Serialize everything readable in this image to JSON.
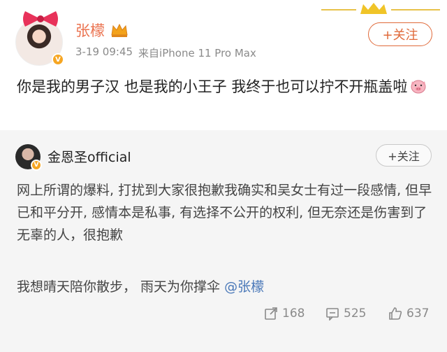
{
  "post": {
    "author": "张檬",
    "time": "3-19 09:45",
    "source": "来自iPhone 11 Pro Max",
    "follow_label": "+关注",
    "text": "你是我的男子汉 也是我的小王子 我终于也可以拧不开瓶盖啦",
    "emoji_icon": "pig-face-icon"
  },
  "repost": {
    "author": "金恩圣official",
    "follow_label": "+关注",
    "paragraph1": "网上所谓的爆料, 打扰到大家很抱歉我确实和吴女士有过一段感情, 但早已和平分开, 感情本是私事, 有选择不公开的权利, 但无奈还是伤害到了无辜的人，很抱歉",
    "paragraph2_prefix": "我想晴天陪你散步，  雨天为你撑伞 ",
    "mention": "@张檬",
    "reposts": "168",
    "comments": "525",
    "likes": "637"
  },
  "colors": {
    "accent": "#eb7350",
    "mention": "#4a78b8",
    "verified_badge": "#f6a623",
    "repost_bg": "#f5f5f5"
  }
}
